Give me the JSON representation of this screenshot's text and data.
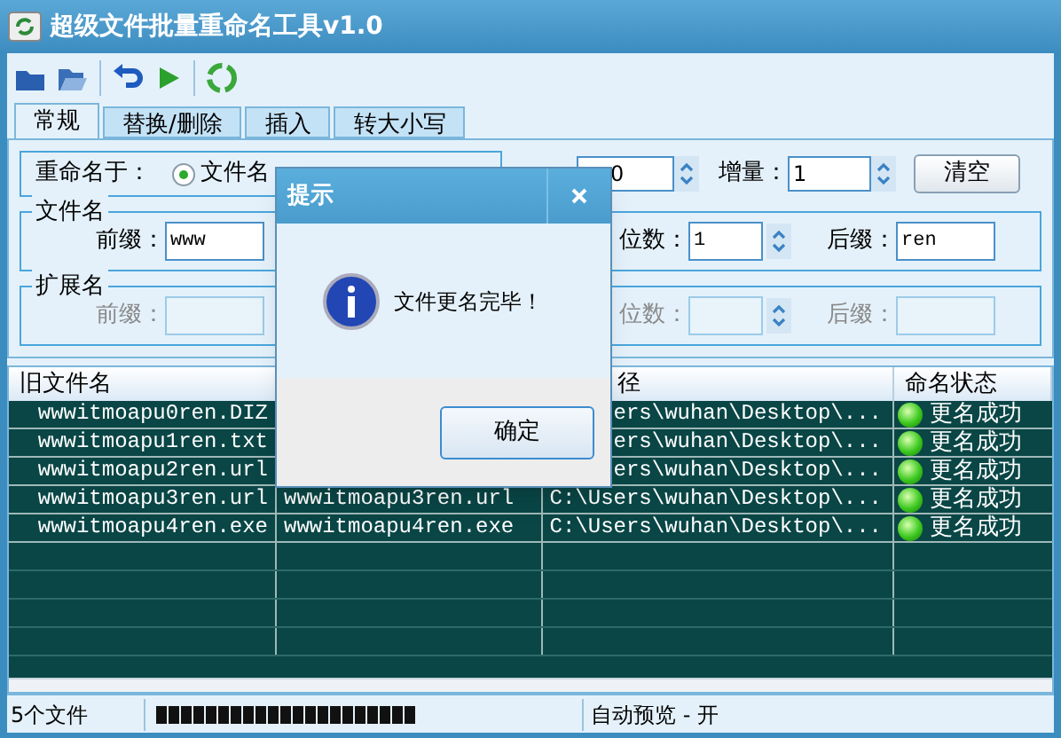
{
  "window": {
    "title": "超级文件批量重命名工具v1.0"
  },
  "tabs": [
    {
      "label": "常规",
      "selected": true
    },
    {
      "label": "替换/删除",
      "selected": false
    },
    {
      "label": "插入",
      "selected": false
    },
    {
      "label": "转大小写",
      "selected": false
    }
  ],
  "rename_target": {
    "label": "重命名于：",
    "options": [
      {
        "label": "文件名",
        "selected": true
      }
    ]
  },
  "start_field": {
    "value": "0"
  },
  "increment": {
    "label": "增量：",
    "value": "1"
  },
  "clear_button": "清空",
  "groups": [
    {
      "title": "文件名",
      "disabled": false,
      "prefix_label": "前缀：",
      "prefix": "www",
      "digits_label": "位数：",
      "digits": "1",
      "suffix_label": "后缀：",
      "suffix": "ren"
    },
    {
      "title": "扩展名",
      "disabled": true,
      "prefix_label": "前缀：",
      "digits_label": "位数：",
      "suffix_label": "后缀："
    }
  ],
  "table": {
    "columns": {
      "old_name": "旧文件名",
      "path": "径",
      "status": "命名状态"
    },
    "rows": [
      {
        "old_name": "wwwitmoapu0ren.DIZ",
        "path": "ers\\wuhan\\Desktop\\...",
        "status": "更名成功",
        "success": true
      },
      {
        "old_name": "wwwitmoapu1ren.txt",
        "path": "ers\\wuhan\\Desktop\\...",
        "status": "更名成功",
        "success": true
      },
      {
        "old_name": "wwwitmoapu2ren.url",
        "path": "ers\\wuhan\\Desktop\\...",
        "status": "更名成功",
        "success": true
      },
      {
        "old_name": "wwwitmoapu3ren.url",
        "new_name": "wwwitmoapu3ren.url",
        "path": "C:\\Users\\wuhan\\Desktop\\...",
        "status": "更名成功",
        "success": true
      },
      {
        "old_name": "wwwitmoapu4ren.exe",
        "new_name": "wwwitmoapu4ren.exe",
        "path": "C:\\Users\\wuhan\\Desktop\\...",
        "status": "更名成功",
        "success": true
      }
    ]
  },
  "status_bar": {
    "file_count": "5个文件",
    "progress": {
      "level": 1
    },
    "auto_preview": "自动预览 - 开"
  },
  "dialog": {
    "title": "提示",
    "message": "文件更名完毕！",
    "ok_button": "确定"
  }
}
